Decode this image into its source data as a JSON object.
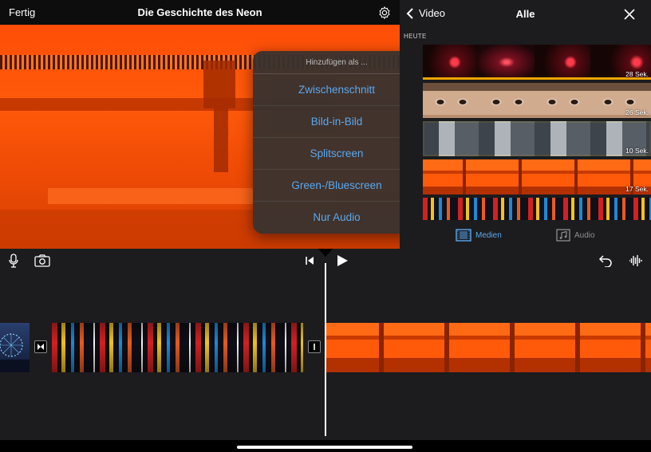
{
  "topbar": {
    "done_label": "Fertig",
    "title": "Die Geschichte des Neon",
    "settings_icon": "gear-icon"
  },
  "popover": {
    "title": "Hinzufügen als ...",
    "items": [
      "Zwischenschnitt",
      "Bild-in-Bild",
      "Splitscreen",
      "Green-/Bluescreen",
      "Nur Audio"
    ],
    "accent_color": "#5aa8ee"
  },
  "browser": {
    "back_label": "Video",
    "title": "Alle",
    "section": "HEUTE",
    "clips": [
      {
        "duration": "28 Sek.",
        "theme": "laser",
        "used": true
      },
      {
        "duration": "26 Sek.",
        "theme": "eyes",
        "used": false
      },
      {
        "duration": "10 Sek.",
        "theme": "machine",
        "selected": true
      },
      {
        "duration": "17 Sek.",
        "theme": "orange-machine",
        "used": false
      },
      {
        "duration": "",
        "theme": "city-night",
        "used": false
      }
    ],
    "tabs": [
      {
        "label": "Medien",
        "icon": "film-icon",
        "active": true
      },
      {
        "label": "Audio",
        "icon": "music-note-icon",
        "active": false
      }
    ]
  },
  "toolbar": {
    "mic_icon": "microphone-icon",
    "camera_icon": "camera-icon",
    "skip_icon": "skip-to-start-icon",
    "play_icon": "play-icon",
    "undo_icon": "undo-icon",
    "waveform_icon": "waveform-icon"
  },
  "colors": {
    "selection": "#f6c300",
    "used_clip_bar": "#f0a500",
    "background": "#1c1c1e"
  }
}
